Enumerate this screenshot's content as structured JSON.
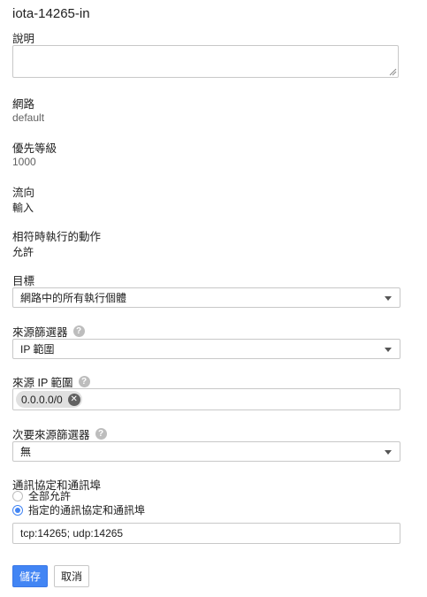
{
  "rule_name": "iota-14265-in",
  "description": {
    "label": "說明",
    "value": ""
  },
  "network": {
    "label": "網路",
    "value": "default"
  },
  "priority": {
    "label": "優先等級",
    "value": "1000"
  },
  "direction": {
    "label": "流向",
    "value": "輸入"
  },
  "action": {
    "label": "相符時執行的動作",
    "value": "允許"
  },
  "targets": {
    "label": "目標",
    "selected": "網路中的所有執行個體"
  },
  "source_filter": {
    "label": "來源篩選器",
    "selected": "IP 範圍",
    "help": "?"
  },
  "source_ip_ranges": {
    "label": "來源 IP 範圍",
    "help": "?",
    "chips": [
      "0.0.0.0/0"
    ]
  },
  "second_source_filter": {
    "label": "次要來源篩選器",
    "selected": "無",
    "help": "?"
  },
  "protocols": {
    "label": "通訊協定和通訊埠",
    "options": [
      "全部允許",
      "指定的通訊協定和通訊埠"
    ],
    "selected_index": 1,
    "value": "tcp:14265; udp:14265"
  },
  "buttons": {
    "save": "儲存",
    "cancel": "取消"
  }
}
